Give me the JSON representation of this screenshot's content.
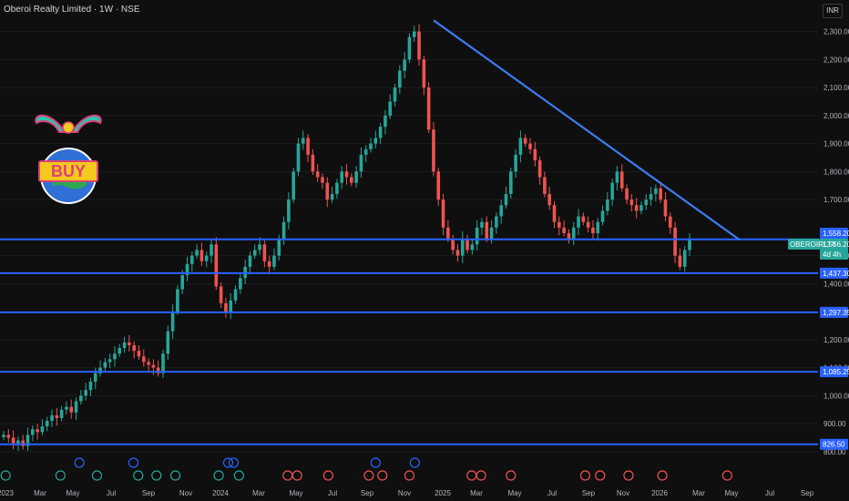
{
  "header": {
    "symbol_title": "Oberoi Realty Limited · 1W · NSE",
    "currency": "INR"
  },
  "colors": {
    "up": "#26a69a",
    "down": "#ef5350",
    "level": "#2962ff",
    "trend": "#3d7bf0",
    "bg": "#0f0f0f"
  },
  "price_badges": {
    "ticker": "OBEROIRLTY",
    "last": "1,556.20",
    "countdown": "4d 4h",
    "level_top": "1,558.20"
  },
  "chart_data": {
    "type": "candlestick",
    "price_range": [
      780,
      2380
    ],
    "price_ticks": [
      "2,300.00",
      "2,200.00",
      "2,100.00",
      "2,000.00",
      "1,900.00",
      "1,800.00",
      "1,700.00",
      "1,500.00",
      "1,400.00",
      "1,200.00",
      "1,100.00",
      "1,000.00",
      "900.00",
      "800.00"
    ],
    "price_tick_values": [
      2300,
      2200,
      2100,
      2000,
      1900,
      1800,
      1700,
      1500,
      1400,
      1200,
      1100,
      1000,
      900,
      800
    ],
    "time_ticks": [
      "2023",
      "Mar",
      "May",
      "Jul",
      "Sep",
      "Nov",
      "2024",
      "Mar",
      "May",
      "Jul",
      "Sep",
      "Nov",
      "2025",
      "Mar",
      "May",
      "Jul",
      "Sep",
      "Nov",
      "2026",
      "Mar",
      "May",
      "Jul",
      "Sep"
    ],
    "horizontal_levels": [
      {
        "value": 1558.2,
        "label": "1,558.20"
      },
      {
        "value": 1437.3,
        "label": "1,437.30"
      },
      {
        "value": 1297.35,
        "label": "1,297.35"
      },
      {
        "value": 1085.25,
        "label": "1,085.25"
      },
      {
        "value": 826.5,
        "label": "826.50"
      }
    ],
    "trendline": {
      "start": [
        "2024-12",
        2340
      ],
      "end": [
        "2026-03",
        1556
      ]
    },
    "event_markers": [
      {
        "t": 0.15,
        "type": "E"
      },
      {
        "t": 4.2,
        "type": "E"
      },
      {
        "t": 5.6,
        "type": "D"
      },
      {
        "t": 6.9,
        "type": "E"
      },
      {
        "t": 9.6,
        "type": "D"
      },
      {
        "t": 9.95,
        "type": "E"
      },
      {
        "t": 11.3,
        "type": "E"
      },
      {
        "t": 12.7,
        "type": "E"
      },
      {
        "t": 15.9,
        "type": "E"
      },
      {
        "t": 16.6,
        "type": "D"
      },
      {
        "t": 17.0,
        "type": "D"
      },
      {
        "t": 17.4,
        "type": "E"
      },
      {
        "t": 21.0,
        "type": "E"
      },
      {
        "t": 21.7,
        "type": "E"
      },
      {
        "t": 24.0,
        "type": "E"
      },
      {
        "t": 27.0,
        "type": "E"
      },
      {
        "t": 27.5,
        "type": "D"
      },
      {
        "t": 28.0,
        "type": "E"
      },
      {
        "t": 30.0,
        "type": "E"
      },
      {
        "t": 30.4,
        "type": "D"
      },
      {
        "t": 34.6,
        "type": "E"
      },
      {
        "t": 35.3,
        "type": "E"
      },
      {
        "t": 37.5,
        "type": "E"
      },
      {
        "t": 43.0,
        "type": "E"
      },
      {
        "t": 44.1,
        "type": "E"
      },
      {
        "t": 46.2,
        "type": "E"
      },
      {
        "t": 48.7,
        "type": "E"
      },
      {
        "t": 53.5,
        "type": "E"
      }
    ],
    "closes": [
      860,
      850,
      830,
      840,
      820,
      860,
      880,
      870,
      890,
      910,
      930,
      920,
      950,
      960,
      940,
      980,
      1000,
      1020,
      1050,
      1080,
      1100,
      1120,
      1130,
      1150,
      1170,
      1190,
      1180,
      1160,
      1140,
      1120,
      1110,
      1100,
      1080,
      1150,
      1230,
      1300,
      1380,
      1430,
      1470,
      1500,
      1520,
      1480,
      1500,
      1540,
      1390,
      1330,
      1300,
      1340,
      1380,
      1420,
      1460,
      1500,
      1520,
      1540,
      1480,
      1460,
      1500,
      1560,
      1620,
      1700,
      1800,
      1900,
      1920,
      1860,
      1800,
      1780,
      1760,
      1700,
      1720,
      1760,
      1800,
      1780,
      1760,
      1800,
      1860,
      1880,
      1900,
      1920,
      1960,
      2000,
      2050,
      2100,
      2160,
      2200,
      2280,
      2300,
      2200,
      2100,
      1950,
      1800,
      1700,
      1600,
      1560,
      1520,
      1500,
      1560,
      1520,
      1540,
      1600,
      1620,
      1560,
      1600,
      1640,
      1680,
      1720,
      1800,
      1860,
      1920,
      1900,
      1880,
      1840,
      1780,
      1720,
      1680,
      1620,
      1600,
      1580,
      1560,
      1600,
      1640,
      1620,
      1600,
      1580,
      1620,
      1660,
      1700,
      1760,
      1800,
      1740,
      1700,
      1680,
      1660,
      1680,
      1700,
      1720,
      1740,
      1700,
      1640,
      1600,
      1500,
      1460,
      1520,
      1560
    ]
  }
}
